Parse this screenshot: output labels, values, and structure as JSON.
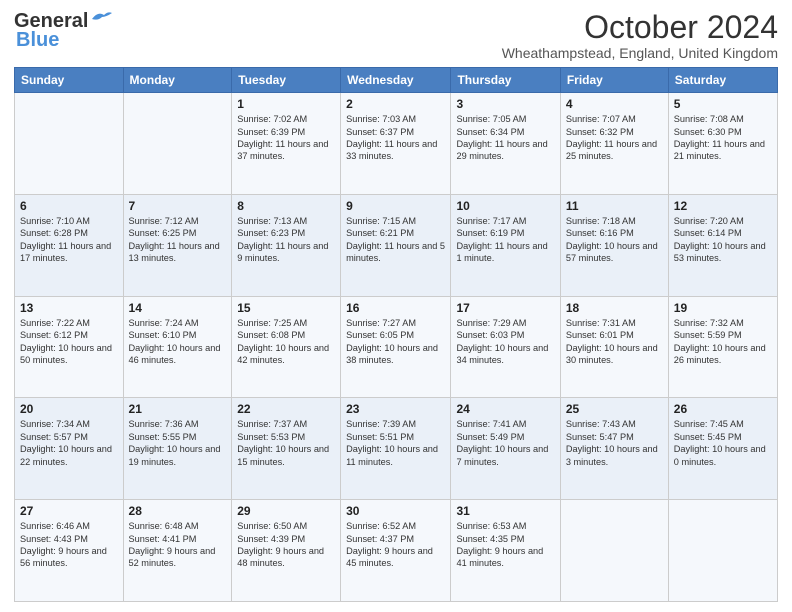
{
  "header": {
    "logo_line1": "General",
    "logo_line2": "Blue",
    "month_title": "October 2024",
    "location": "Wheathampstead, England, United Kingdom"
  },
  "days_of_week": [
    "Sunday",
    "Monday",
    "Tuesday",
    "Wednesday",
    "Thursday",
    "Friday",
    "Saturday"
  ],
  "weeks": [
    [
      {
        "day": "",
        "content": ""
      },
      {
        "day": "",
        "content": ""
      },
      {
        "day": "1",
        "content": "Sunrise: 7:02 AM\nSunset: 6:39 PM\nDaylight: 11 hours and 37 minutes."
      },
      {
        "day": "2",
        "content": "Sunrise: 7:03 AM\nSunset: 6:37 PM\nDaylight: 11 hours and 33 minutes."
      },
      {
        "day": "3",
        "content": "Sunrise: 7:05 AM\nSunset: 6:34 PM\nDaylight: 11 hours and 29 minutes."
      },
      {
        "day": "4",
        "content": "Sunrise: 7:07 AM\nSunset: 6:32 PM\nDaylight: 11 hours and 25 minutes."
      },
      {
        "day": "5",
        "content": "Sunrise: 7:08 AM\nSunset: 6:30 PM\nDaylight: 11 hours and 21 minutes."
      }
    ],
    [
      {
        "day": "6",
        "content": "Sunrise: 7:10 AM\nSunset: 6:28 PM\nDaylight: 11 hours and 17 minutes."
      },
      {
        "day": "7",
        "content": "Sunrise: 7:12 AM\nSunset: 6:25 PM\nDaylight: 11 hours and 13 minutes."
      },
      {
        "day": "8",
        "content": "Sunrise: 7:13 AM\nSunset: 6:23 PM\nDaylight: 11 hours and 9 minutes."
      },
      {
        "day": "9",
        "content": "Sunrise: 7:15 AM\nSunset: 6:21 PM\nDaylight: 11 hours and 5 minutes."
      },
      {
        "day": "10",
        "content": "Sunrise: 7:17 AM\nSunset: 6:19 PM\nDaylight: 11 hours and 1 minute."
      },
      {
        "day": "11",
        "content": "Sunrise: 7:18 AM\nSunset: 6:16 PM\nDaylight: 10 hours and 57 minutes."
      },
      {
        "day": "12",
        "content": "Sunrise: 7:20 AM\nSunset: 6:14 PM\nDaylight: 10 hours and 53 minutes."
      }
    ],
    [
      {
        "day": "13",
        "content": "Sunrise: 7:22 AM\nSunset: 6:12 PM\nDaylight: 10 hours and 50 minutes."
      },
      {
        "day": "14",
        "content": "Sunrise: 7:24 AM\nSunset: 6:10 PM\nDaylight: 10 hours and 46 minutes."
      },
      {
        "day": "15",
        "content": "Sunrise: 7:25 AM\nSunset: 6:08 PM\nDaylight: 10 hours and 42 minutes."
      },
      {
        "day": "16",
        "content": "Sunrise: 7:27 AM\nSunset: 6:05 PM\nDaylight: 10 hours and 38 minutes."
      },
      {
        "day": "17",
        "content": "Sunrise: 7:29 AM\nSunset: 6:03 PM\nDaylight: 10 hours and 34 minutes."
      },
      {
        "day": "18",
        "content": "Sunrise: 7:31 AM\nSunset: 6:01 PM\nDaylight: 10 hours and 30 minutes."
      },
      {
        "day": "19",
        "content": "Sunrise: 7:32 AM\nSunset: 5:59 PM\nDaylight: 10 hours and 26 minutes."
      }
    ],
    [
      {
        "day": "20",
        "content": "Sunrise: 7:34 AM\nSunset: 5:57 PM\nDaylight: 10 hours and 22 minutes."
      },
      {
        "day": "21",
        "content": "Sunrise: 7:36 AM\nSunset: 5:55 PM\nDaylight: 10 hours and 19 minutes."
      },
      {
        "day": "22",
        "content": "Sunrise: 7:37 AM\nSunset: 5:53 PM\nDaylight: 10 hours and 15 minutes."
      },
      {
        "day": "23",
        "content": "Sunrise: 7:39 AM\nSunset: 5:51 PM\nDaylight: 10 hours and 11 minutes."
      },
      {
        "day": "24",
        "content": "Sunrise: 7:41 AM\nSunset: 5:49 PM\nDaylight: 10 hours and 7 minutes."
      },
      {
        "day": "25",
        "content": "Sunrise: 7:43 AM\nSunset: 5:47 PM\nDaylight: 10 hours and 3 minutes."
      },
      {
        "day": "26",
        "content": "Sunrise: 7:45 AM\nSunset: 5:45 PM\nDaylight: 10 hours and 0 minutes."
      }
    ],
    [
      {
        "day": "27",
        "content": "Sunrise: 6:46 AM\nSunset: 4:43 PM\nDaylight: 9 hours and 56 minutes."
      },
      {
        "day": "28",
        "content": "Sunrise: 6:48 AM\nSunset: 4:41 PM\nDaylight: 9 hours and 52 minutes."
      },
      {
        "day": "29",
        "content": "Sunrise: 6:50 AM\nSunset: 4:39 PM\nDaylight: 9 hours and 48 minutes."
      },
      {
        "day": "30",
        "content": "Sunrise: 6:52 AM\nSunset: 4:37 PM\nDaylight: 9 hours and 45 minutes."
      },
      {
        "day": "31",
        "content": "Sunrise: 6:53 AM\nSunset: 4:35 PM\nDaylight: 9 hours and 41 minutes."
      },
      {
        "day": "",
        "content": ""
      },
      {
        "day": "",
        "content": ""
      }
    ]
  ]
}
